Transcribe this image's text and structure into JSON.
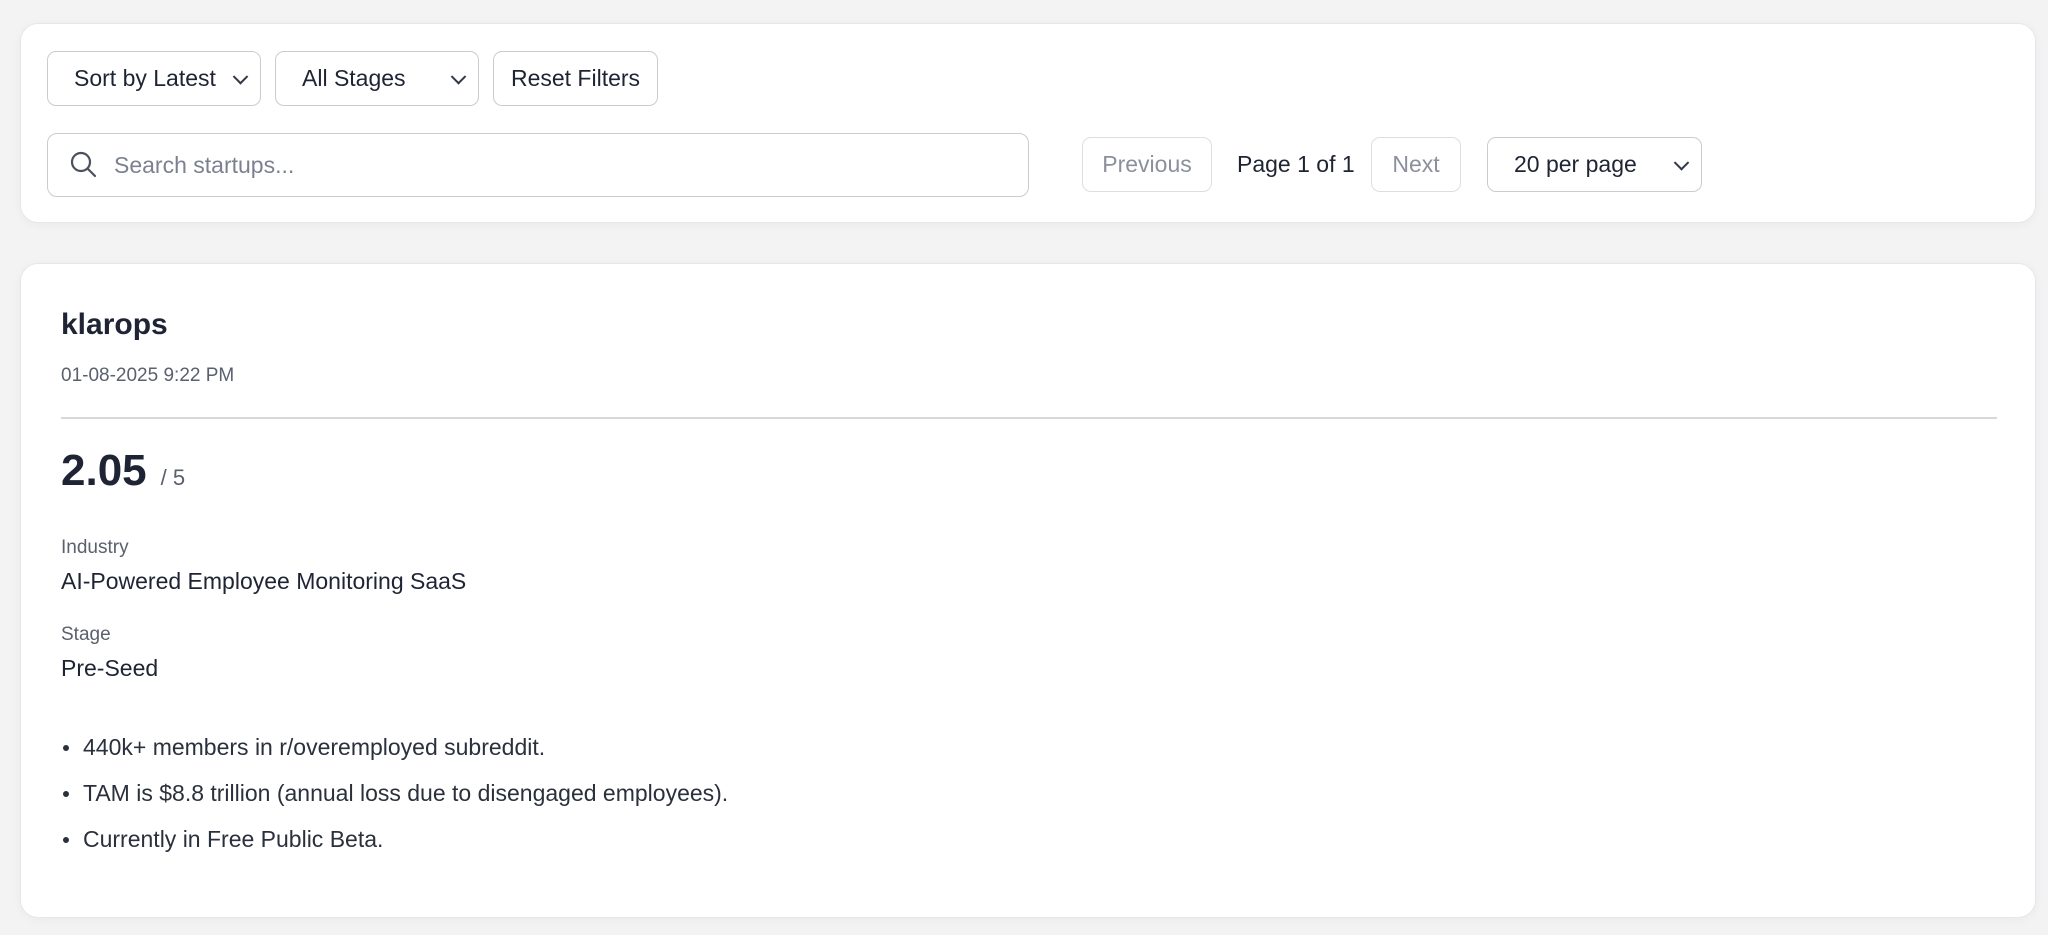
{
  "filters": {
    "sort_label": "Sort by Latest",
    "stage_label": "All Stages",
    "reset_label": "Reset Filters",
    "search_placeholder": "Search startups...",
    "search_value": "",
    "search_icon": "search-icon",
    "chevron_icon": "chevron-down-icon"
  },
  "pagination": {
    "previous_label": "Previous",
    "page_indicator": "Page 1 of 1",
    "next_label": "Next",
    "per_page_label": "20 per page"
  },
  "startup": {
    "name": "klarops",
    "timestamp": "01-08-2025 9:22 PM",
    "score": "2.05",
    "score_max": "/ 5",
    "industry_label": "Industry",
    "industry": "AI-Powered Employee Monitoring SaaS",
    "stage_label": "Stage",
    "stage": "Pre-Seed",
    "highlights": [
      "440k+ members in r/overemployed subreddit.",
      "TAM is $8.8 trillion (annual loss due to disengaged employees).",
      "Currently in Free Public Beta."
    ]
  },
  "colors": {
    "background": "#f3f3f4",
    "card": "#ffffff",
    "text": "#1e2433",
    "muted": "#5a606c",
    "border": "#c9ccd2"
  }
}
